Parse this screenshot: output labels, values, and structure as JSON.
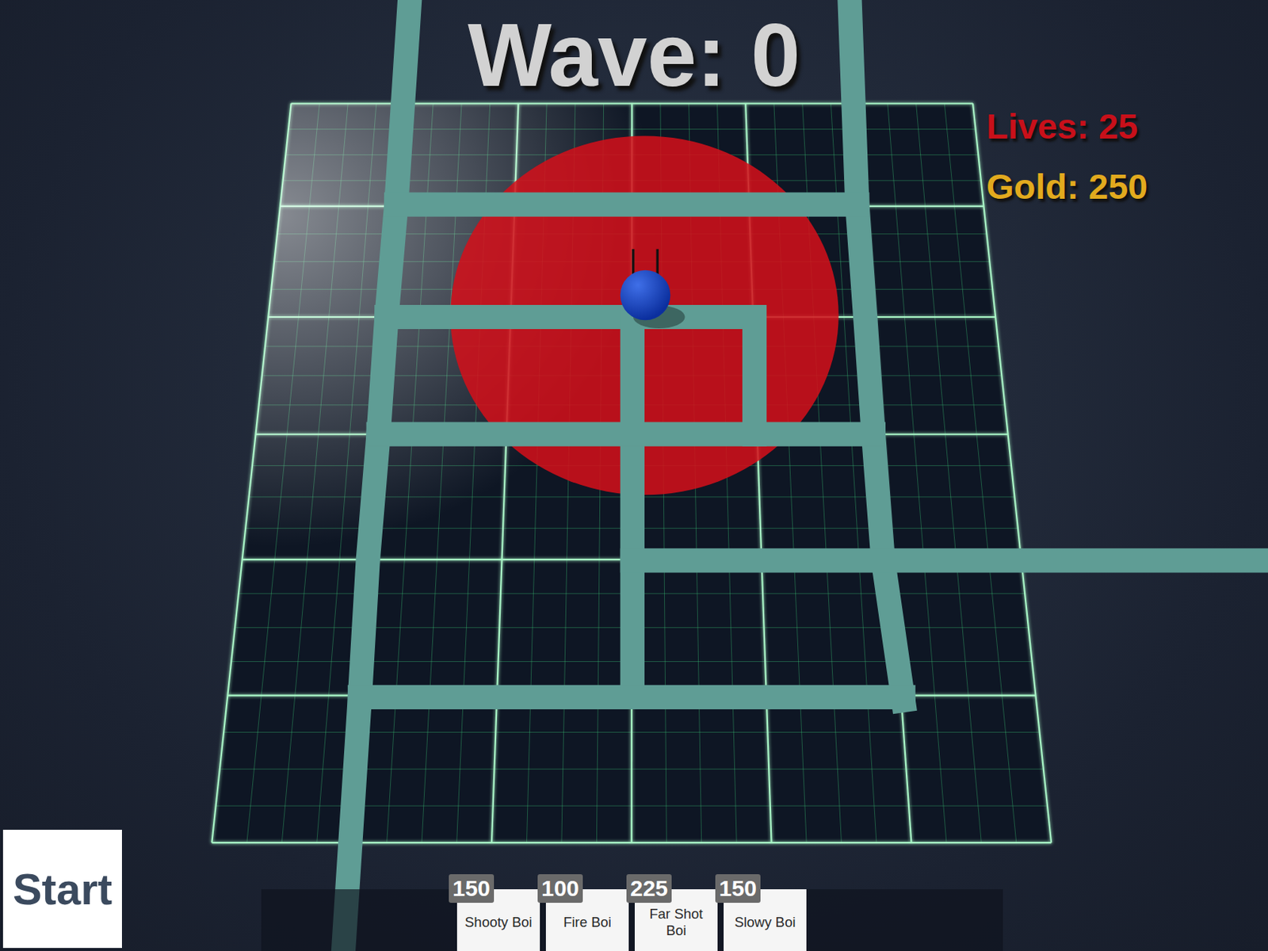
{
  "hud": {
    "wave": "Wave: 0",
    "lives": "Lives: 25",
    "gold": "Gold: 250"
  },
  "start_button": "Start",
  "shop": [
    {
      "cost": "150",
      "name": "Shooty Boi"
    },
    {
      "cost": "100",
      "name": "Fire Boi"
    },
    {
      "cost": "225",
      "name": "Far Shot Boi"
    },
    {
      "cost": "150",
      "name": "Slowy Boi"
    }
  ]
}
